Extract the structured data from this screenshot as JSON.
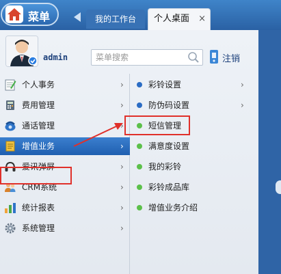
{
  "header": {
    "menu_label": "菜单",
    "tabs": [
      {
        "label": "我的工作台",
        "active": false
      },
      {
        "label": "个人桌面",
        "active": true,
        "close": "×"
      }
    ]
  },
  "user": {
    "name": "admin"
  },
  "search": {
    "placeholder": "菜单搜索"
  },
  "logout": {
    "label": "注销"
  },
  "left_menu": [
    {
      "label": "个人事务",
      "icon": "notepad-icon",
      "arrow": "›"
    },
    {
      "label": "费用管理",
      "icon": "calculator-icon",
      "arrow": "›"
    },
    {
      "label": "通话管理",
      "icon": "telephone-icon",
      "arrow": "›"
    },
    {
      "label": "增值业务",
      "icon": "document-icon",
      "arrow": "›",
      "active": true
    },
    {
      "label": "爱讯弹屏",
      "icon": "headset-icon",
      "arrow": "›"
    },
    {
      "label": "CRM系统",
      "icon": "users-icon",
      "arrow": "›"
    },
    {
      "label": "统计报表",
      "icon": "bar-chart-icon",
      "arrow": "›"
    },
    {
      "label": "系统管理",
      "icon": "gear-icon",
      "arrow": "›"
    }
  ],
  "right_menu": [
    {
      "label": "彩铃设置",
      "dot": "blue",
      "arrow": "›"
    },
    {
      "label": "防伪码设置",
      "dot": "blue",
      "arrow": "›"
    },
    {
      "label": "短信管理",
      "dot": "green"
    },
    {
      "label": "满意度设置",
      "dot": "green"
    },
    {
      "label": "我的彩铃",
      "dot": "green"
    },
    {
      "label": "彩铃成品库",
      "dot": "green"
    },
    {
      "label": "增值业务介绍",
      "dot": "green"
    }
  ],
  "colors": {
    "blue_dot": "#2b6cc4",
    "green_dot": "#5cc04a",
    "highlight": "#e0302a"
  }
}
